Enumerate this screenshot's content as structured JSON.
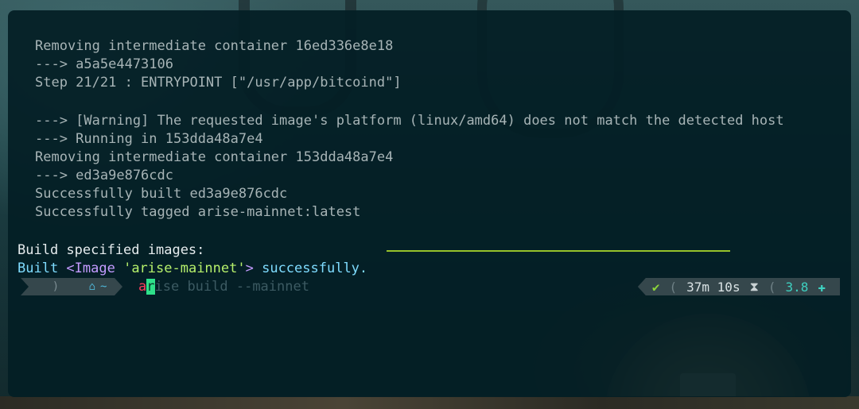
{
  "output_lines": [
    "Removing intermediate container 16ed336e8e18",
    "---> a5a5e4473106",
    "Step 21/21 : ENTRYPOINT [\"/usr/app/bitcoind\"]",
    "",
    "---> [Warning] The requested image's platform (linux/amd64) does not match the detected host",
    "---> Running in 153dda48a7e4",
    "Removing intermediate container 153dda48a7e4",
    "---> ed3a9e876cdc",
    "Successfully built ed3a9e876cdc",
    "Successfully tagged arise-mainnet:latest"
  ],
  "build_specified": "Build specified images:",
  "built_message": {
    "prefix": "Built ",
    "tag_open": "<Image ",
    "image_name": "'arise-mainnet'",
    "tag_close": ">",
    "suffix": " successfully."
  },
  "prompt": {
    "apple_icon": "",
    "divider": ")",
    "home_icon": "⌂",
    "home_dir": "~",
    "command_first": "a",
    "command_cursor": "r",
    "command_rest": "ise build --mainnet",
    "status_check": "✔",
    "status_divider": "(",
    "duration": "37m 10s",
    "hourglass": "⧗",
    "version": "3.8",
    "plus_icon": "✚"
  },
  "colors": {
    "accent_green": "#97c22b",
    "error_red": "#ff3b5c",
    "cursor_green": "#2fe08a",
    "cyan": "#3ed0c0"
  }
}
